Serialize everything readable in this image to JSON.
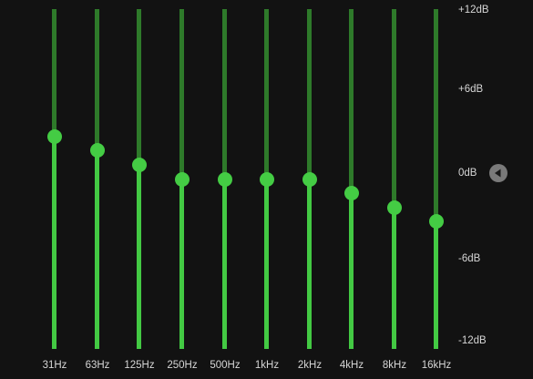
{
  "equalizer": {
    "scale_labels": [
      "+12dB",
      "+6dB",
      "0dB",
      "-6dB",
      "-12dB"
    ],
    "range_db": [
      -12,
      12
    ],
    "bands": [
      {
        "label": "31Hz",
        "gain_db": 3
      },
      {
        "label": "63Hz",
        "gain_db": 2
      },
      {
        "label": "125Hz",
        "gain_db": 1
      },
      {
        "label": "250Hz",
        "gain_db": 0
      },
      {
        "label": "500Hz",
        "gain_db": 0
      },
      {
        "label": "1kHz",
        "gain_db": 0
      },
      {
        "label": "2kHz",
        "gain_db": 0
      },
      {
        "label": "4kHz",
        "gain_db": -1
      },
      {
        "label": "8kHz",
        "gain_db": -2
      },
      {
        "label": "16kHz",
        "gain_db": -3
      }
    ],
    "reset_icon": "triangle-left-icon",
    "colors": {
      "track": "#2e7a2a",
      "fill": "#43c943",
      "knob": "#44cc44",
      "background": "#121212"
    }
  }
}
